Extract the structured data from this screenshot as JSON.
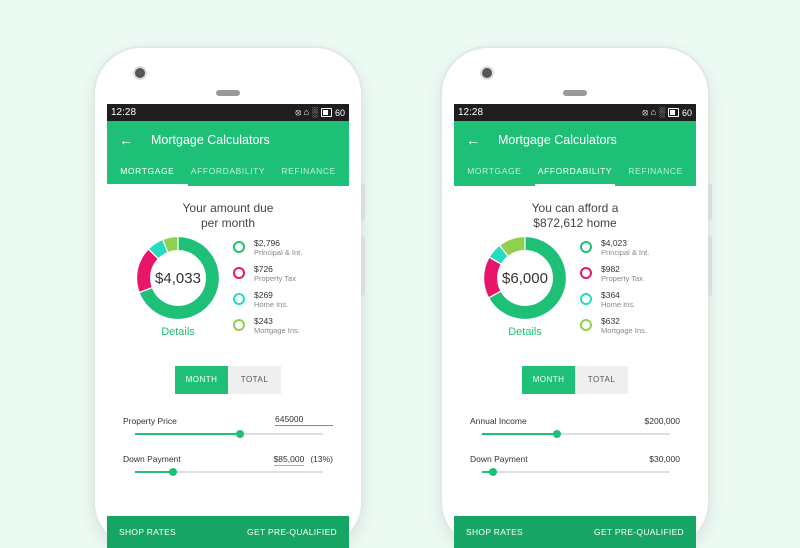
{
  "phones": [
    {
      "status": {
        "time": "12:28",
        "battery": "60",
        "icons": "⦻ ⌂ ░"
      },
      "title": "Mortgage Calculators",
      "tabs": [
        "MORTGAGE",
        "AFFORDABILITY",
        "REFINANCE"
      ],
      "active_tab": 0,
      "heading": [
        "Your amount due",
        "per month"
      ],
      "donut_total": "$4,033",
      "details_label": "Details",
      "legend": [
        {
          "amount": "$2,796",
          "label": "Principal & Int.",
          "color": "#1ec078"
        },
        {
          "amount": "$726",
          "label": "Property Tax",
          "color": "#e9156b"
        },
        {
          "amount": "$269",
          "label": "Home Ins.",
          "color": "#26dcc0"
        },
        {
          "amount": "$243",
          "label": "Mortgage Ins.",
          "color": "#8fd14f"
        }
      ],
      "toggle": [
        "MONTH",
        "TOTAL"
      ],
      "fields": [
        {
          "label": "Property Price",
          "value": "645000",
          "suffix": "",
          "slider": 0.56
        },
        {
          "label": "Down Payment",
          "value": "$85,000",
          "suffix": "(13%)",
          "slider": 0.2
        }
      ],
      "bottom": {
        "left": "SHOP RATES",
        "right": "GET PRE-QUALIFIED"
      }
    },
    {
      "status": {
        "time": "12:28",
        "battery": "60",
        "icons": "⦻ ⌂ ░"
      },
      "title": "Mortgage Calculators",
      "tabs": [
        "MORTGAGE",
        "AFFORDABILITY",
        "REFINANCE"
      ],
      "active_tab": 1,
      "heading": [
        "You can afford a",
        "$872,612  home"
      ],
      "donut_total": "$6,000",
      "details_label": "Details",
      "legend": [
        {
          "amount": "$4,023",
          "label": "Principal & Int.",
          "color": "#1ec078"
        },
        {
          "amount": "$982",
          "label": "Property Tax",
          "color": "#e9156b"
        },
        {
          "amount": "$364",
          "label": "Home Ins.",
          "color": "#26dcc0"
        },
        {
          "amount": "$632",
          "label": "Mortgage Ins.",
          "color": "#8fd14f"
        }
      ],
      "toggle": [
        "MONTH",
        "TOTAL"
      ],
      "fields": [
        {
          "label": "Annual Income",
          "value": "$200,000",
          "suffix": "",
          "slider": 0.4
        },
        {
          "label": "Down Payment",
          "value": "$30,000",
          "suffix": "",
          "slider": 0.06
        }
      ],
      "bottom": {
        "left": "SHOP RATES",
        "right": "GET PRE-QUALIFIED"
      }
    }
  ]
}
